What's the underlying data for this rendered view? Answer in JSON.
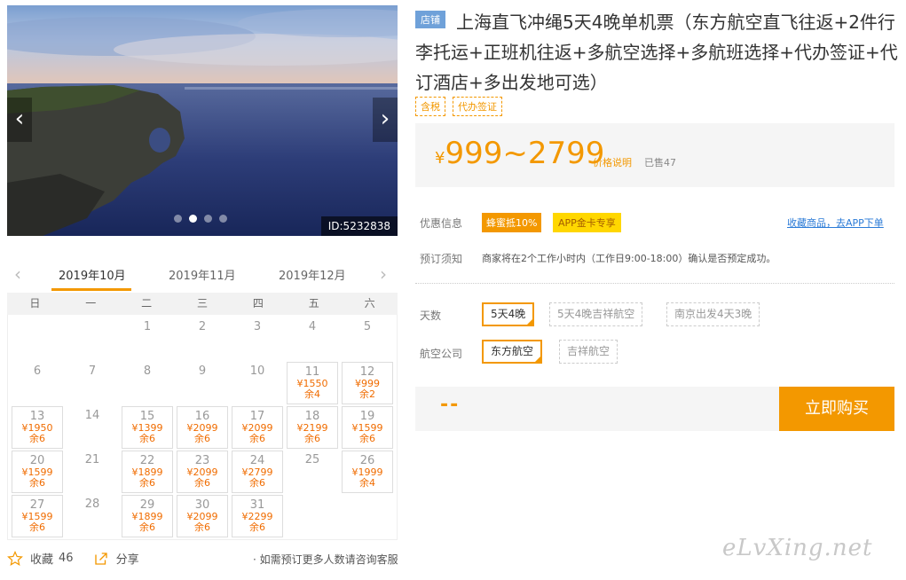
{
  "gallery": {
    "image_id": "ID:5232838",
    "dots": 4,
    "active_dot": 1,
    "prev_icon": "chevron-left-icon",
    "next_icon": "chevron-right-icon"
  },
  "calendar": {
    "months": [
      "2019年10月",
      "2019年11月",
      "2019年12月"
    ],
    "active_month": 0,
    "weekdays": [
      "日",
      "一",
      "二",
      "三",
      "四",
      "五",
      "六"
    ],
    "first_weekday": 2,
    "days_in_month": 31,
    "prices": {
      "11": {
        "price": "¥1550",
        "left": "余4"
      },
      "12": {
        "price": "¥999",
        "left": "余2"
      },
      "13": {
        "price": "¥1950",
        "left": "余6"
      },
      "15": {
        "price": "¥1399",
        "left": "余6"
      },
      "16": {
        "price": "¥2099",
        "left": "余6"
      },
      "17": {
        "price": "¥2099",
        "left": "余6"
      },
      "18": {
        "price": "¥2199",
        "left": "余6"
      },
      "19": {
        "price": "¥1599",
        "left": "余6"
      },
      "20": {
        "price": "¥1599",
        "left": "余6"
      },
      "22": {
        "price": "¥1899",
        "left": "余6"
      },
      "23": {
        "price": "¥2099",
        "left": "余6"
      },
      "24": {
        "price": "¥2799",
        "left": "余6"
      },
      "26": {
        "price": "¥1999",
        "left": "余4"
      },
      "27": {
        "price": "¥1599",
        "left": "余6"
      },
      "29": {
        "price": "¥1899",
        "left": "余6"
      },
      "30": {
        "price": "¥2099",
        "left": "余6"
      },
      "31": {
        "price": "¥2299",
        "left": "余6"
      }
    }
  },
  "footer": {
    "collect_label": "收藏",
    "collect_count": "46",
    "share_label": "分享",
    "consult_text": "· 如需预订更多人数请咨询客服"
  },
  "product": {
    "shop_badge": "店铺",
    "title": "上海直飞冲绳5天4晚单机票（东方航空直飞往返+2件行李托运+正班机往返+多航空选择+多航班选择+代办签证+代订酒店+多出发地可选）",
    "tags": [
      "含税",
      "代办签证"
    ],
    "price_symbol": "¥",
    "price_range": "999~2799",
    "price_note": "价格说明",
    "sold": "已售47",
    "promo_label": "优惠信息",
    "promo_1": "蜂蜜抵10%",
    "promo_2": "APP金卡专享",
    "collect_link": "收藏商品，去APP下单",
    "notice_label": "预订须知",
    "notice_text": "商家将在2个工作小时内（工作日9:00-18:00）确认是否预定成功。",
    "days_label": "天数",
    "days_options": [
      "5天4晚",
      "5天4晚吉祥航空",
      "南京出发4天3晚"
    ],
    "airline_label": "航空公司",
    "airline_options": [
      "东方航空",
      "吉祥航空"
    ],
    "quantity_display": "--",
    "buy_label": "立即购买"
  },
  "watermark": "eLvXing.net",
  "colors": {
    "accent": "#f39800",
    "link": "#2b7bd7",
    "price": "#f06c00"
  }
}
